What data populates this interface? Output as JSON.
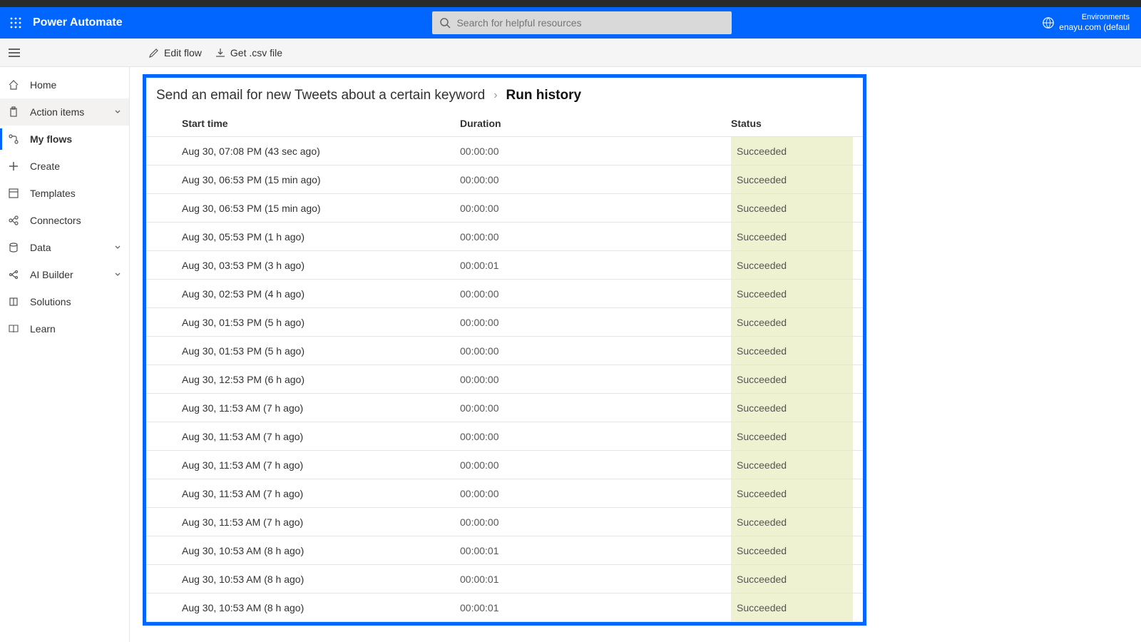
{
  "header": {
    "brand": "Power Automate",
    "search_placeholder": "Search for helpful resources",
    "env_label": "Environments",
    "env_value": "enayu.com (defaul"
  },
  "toolbar": {
    "edit_label": "Edit flow",
    "csv_label": "Get .csv file"
  },
  "sidebar": {
    "items": [
      {
        "label": "Home",
        "name": "sidebar-item-home",
        "icon": "home"
      },
      {
        "label": "Action items",
        "name": "sidebar-item-action-items",
        "icon": "clipboard",
        "hover": true,
        "chev": true
      },
      {
        "label": "My flows",
        "name": "sidebar-item-my-flows",
        "icon": "flow",
        "active": true
      },
      {
        "label": "Create",
        "name": "sidebar-item-create",
        "icon": "plus"
      },
      {
        "label": "Templates",
        "name": "sidebar-item-templates",
        "icon": "templates"
      },
      {
        "label": "Connectors",
        "name": "sidebar-item-connectors",
        "icon": "connectors"
      },
      {
        "label": "Data",
        "name": "sidebar-item-data",
        "icon": "data",
        "chev": true
      },
      {
        "label": "AI Builder",
        "name": "sidebar-item-ai-builder",
        "icon": "ai",
        "chev": true
      },
      {
        "label": "Solutions",
        "name": "sidebar-item-solutions",
        "icon": "solutions"
      },
      {
        "label": "Learn",
        "name": "sidebar-item-learn",
        "icon": "learn"
      }
    ]
  },
  "breadcrumb": {
    "crumb": "Send an email for new Tweets about a certain keyword",
    "current": "Run history"
  },
  "table": {
    "headers": {
      "start": "Start time",
      "duration": "Duration",
      "status": "Status"
    },
    "rows": [
      {
        "start": "Aug 30, 07:08 PM (43 sec ago)",
        "dur": "00:00:00",
        "stat": "Succeeded"
      },
      {
        "start": "Aug 30, 06:53 PM (15 min ago)",
        "dur": "00:00:00",
        "stat": "Succeeded"
      },
      {
        "start": "Aug 30, 06:53 PM (15 min ago)",
        "dur": "00:00:00",
        "stat": "Succeeded"
      },
      {
        "start": "Aug 30, 05:53 PM (1 h ago)",
        "dur": "00:00:00",
        "stat": "Succeeded"
      },
      {
        "start": "Aug 30, 03:53 PM (3 h ago)",
        "dur": "00:00:01",
        "stat": "Succeeded"
      },
      {
        "start": "Aug 30, 02:53 PM (4 h ago)",
        "dur": "00:00:00",
        "stat": "Succeeded"
      },
      {
        "start": "Aug 30, 01:53 PM (5 h ago)",
        "dur": "00:00:00",
        "stat": "Succeeded"
      },
      {
        "start": "Aug 30, 01:53 PM (5 h ago)",
        "dur": "00:00:00",
        "stat": "Succeeded"
      },
      {
        "start": "Aug 30, 12:53 PM (6 h ago)",
        "dur": "00:00:00",
        "stat": "Succeeded"
      },
      {
        "start": "Aug 30, 11:53 AM (7 h ago)",
        "dur": "00:00:00",
        "stat": "Succeeded"
      },
      {
        "start": "Aug 30, 11:53 AM (7 h ago)",
        "dur": "00:00:00",
        "stat": "Succeeded"
      },
      {
        "start": "Aug 30, 11:53 AM (7 h ago)",
        "dur": "00:00:00",
        "stat": "Succeeded"
      },
      {
        "start": "Aug 30, 11:53 AM (7 h ago)",
        "dur": "00:00:00",
        "stat": "Succeeded"
      },
      {
        "start": "Aug 30, 11:53 AM (7 h ago)",
        "dur": "00:00:00",
        "stat": "Succeeded"
      },
      {
        "start": "Aug 30, 10:53 AM (8 h ago)",
        "dur": "00:00:01",
        "stat": "Succeeded"
      },
      {
        "start": "Aug 30, 10:53 AM (8 h ago)",
        "dur": "00:00:01",
        "stat": "Succeeded"
      },
      {
        "start": "Aug 30, 10:53 AM (8 h ago)",
        "dur": "00:00:01",
        "stat": "Succeeded"
      }
    ]
  }
}
